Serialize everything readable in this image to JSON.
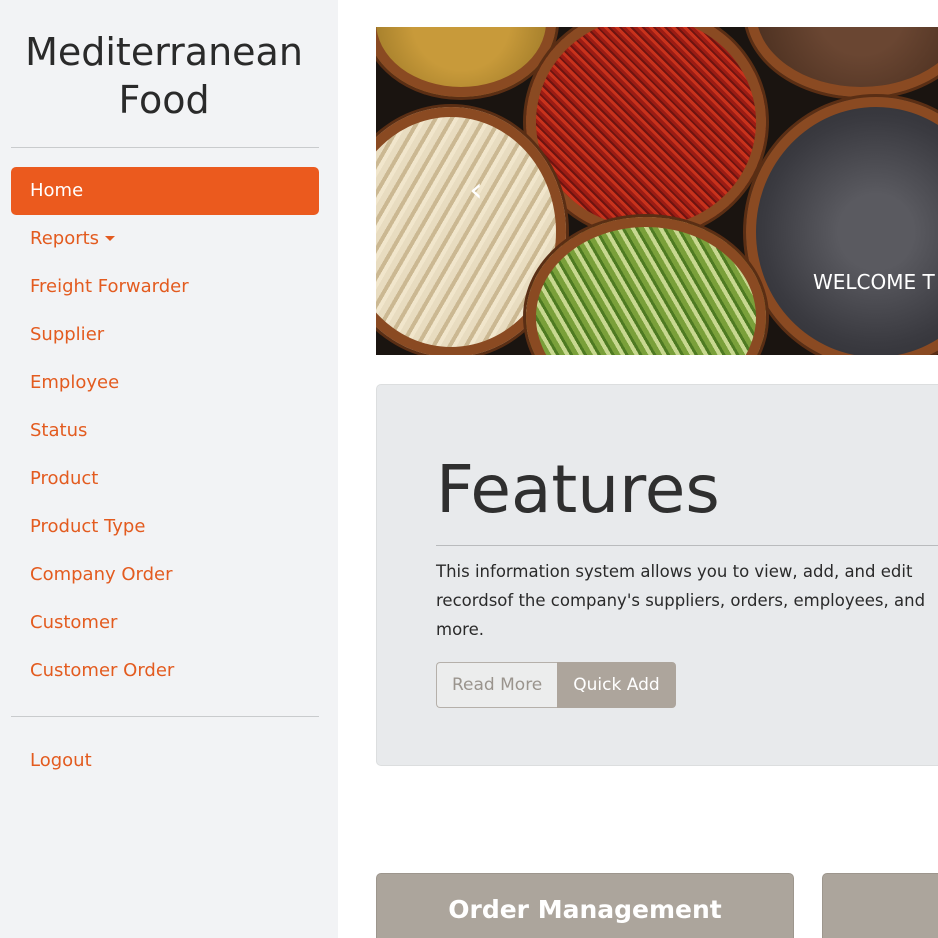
{
  "sidebar": {
    "brand": "Mediterranean Food",
    "nav": [
      {
        "label": "Home",
        "active": true
      },
      {
        "label": "Reports",
        "dropdown": true
      },
      {
        "label": "Freight Forwarder"
      },
      {
        "label": "Supplier"
      },
      {
        "label": "Employee"
      },
      {
        "label": "Status"
      },
      {
        "label": "Product"
      },
      {
        "label": "Product Type"
      },
      {
        "label": "Company Order"
      },
      {
        "label": "Customer"
      },
      {
        "label": "Customer Order"
      }
    ],
    "logout": "Logout"
  },
  "carousel": {
    "prev_icon": "‹",
    "caption": "WELCOME T"
  },
  "features": {
    "title": "Features",
    "text": "This information system allows you to view, add, and edit recordsof the company's suppliers, orders, employees, and more.",
    "read_more": "Read More",
    "quick_add": "Quick Add"
  },
  "cards": {
    "order_management": "Order Management",
    "second": ""
  },
  "colors": {
    "accent": "#eb5a1e",
    "sidebar_bg": "#f2f3f5",
    "card_bg": "#aca59c"
  }
}
